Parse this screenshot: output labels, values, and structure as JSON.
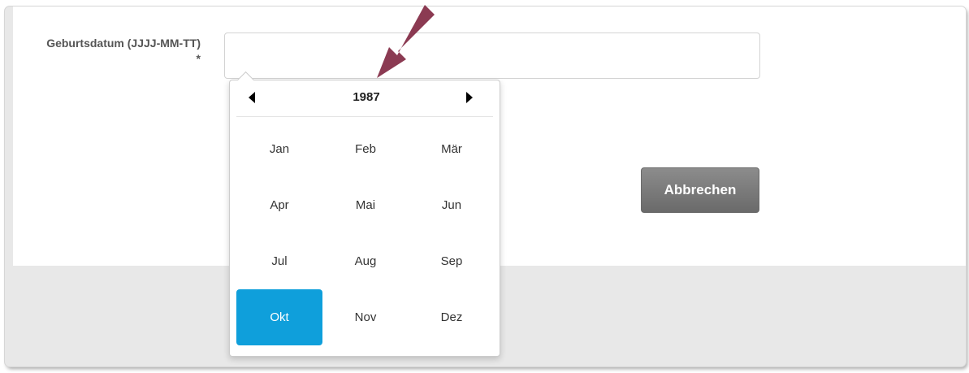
{
  "form": {
    "birthdate_label": "Geburtsdatum (JJJJ-MM-TT) *",
    "birthdate_value": "",
    "cancel_label": "Abbrechen"
  },
  "datepicker": {
    "year": "1987",
    "months": [
      "Jan",
      "Feb",
      "Mär",
      "Apr",
      "Mai",
      "Jun",
      "Jul",
      "Aug",
      "Sep",
      "Okt",
      "Nov",
      "Dez"
    ],
    "selected_month": "Okt",
    "prev_icon": "triangle-left",
    "next_icon": "triangle-right"
  },
  "colors": {
    "accent": "#0f9fdb",
    "annotation_arrow": "#8b3a52",
    "button_gray": "#7a7a7a"
  }
}
